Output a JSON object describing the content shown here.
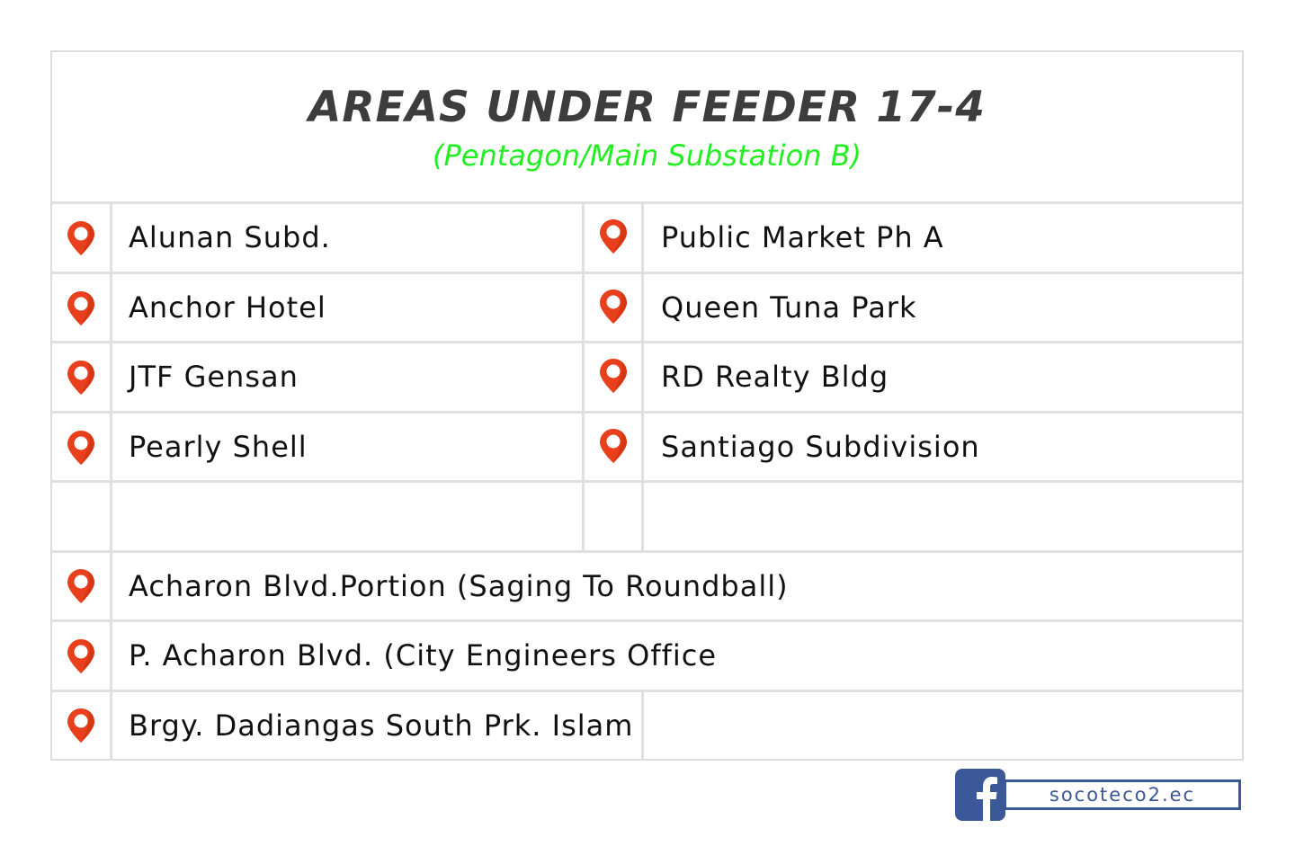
{
  "header": {
    "title": "AREAS UNDER FEEDER 17-4",
    "subtitle": "(Pentagon/Main Substation B)"
  },
  "colors": {
    "title": "#3d3d3d",
    "subtitle": "#22ee22",
    "pin": "#e8401c",
    "grid": "#e0e0e0",
    "facebook": "#3b5998"
  },
  "areas": {
    "left_column": [
      {
        "icon": "map-pin-icon",
        "label": "Alunan Subd."
      },
      {
        "icon": "map-pin-icon",
        "label": "Anchor Hotel"
      },
      {
        "icon": "map-pin-icon",
        "label": "JTF Gensan"
      },
      {
        "icon": "map-pin-icon",
        "label": "Pearly Shell"
      }
    ],
    "right_column": [
      {
        "icon": "map-pin-icon",
        "label": "Public Market Ph A"
      },
      {
        "icon": "map-pin-icon",
        "label": "Queen Tuna Park"
      },
      {
        "icon": "map-pin-icon",
        "label": "RD Realty Bldg"
      },
      {
        "icon": "map-pin-icon",
        "label": "Santiago Subdivision"
      }
    ],
    "full_width": [
      {
        "icon": "map-pin-icon",
        "label": "Acharon Blvd.Portion (Saging To Roundball)"
      },
      {
        "icon": "map-pin-icon",
        "label": "P. Acharon Blvd. (City Engineers Office"
      },
      {
        "icon": "map-pin-icon",
        "label": "Brgy. Dadiangas South Prk. Islam"
      }
    ]
  },
  "footer": {
    "social_icon": "facebook-icon",
    "handle": "socoteco2.ec"
  }
}
